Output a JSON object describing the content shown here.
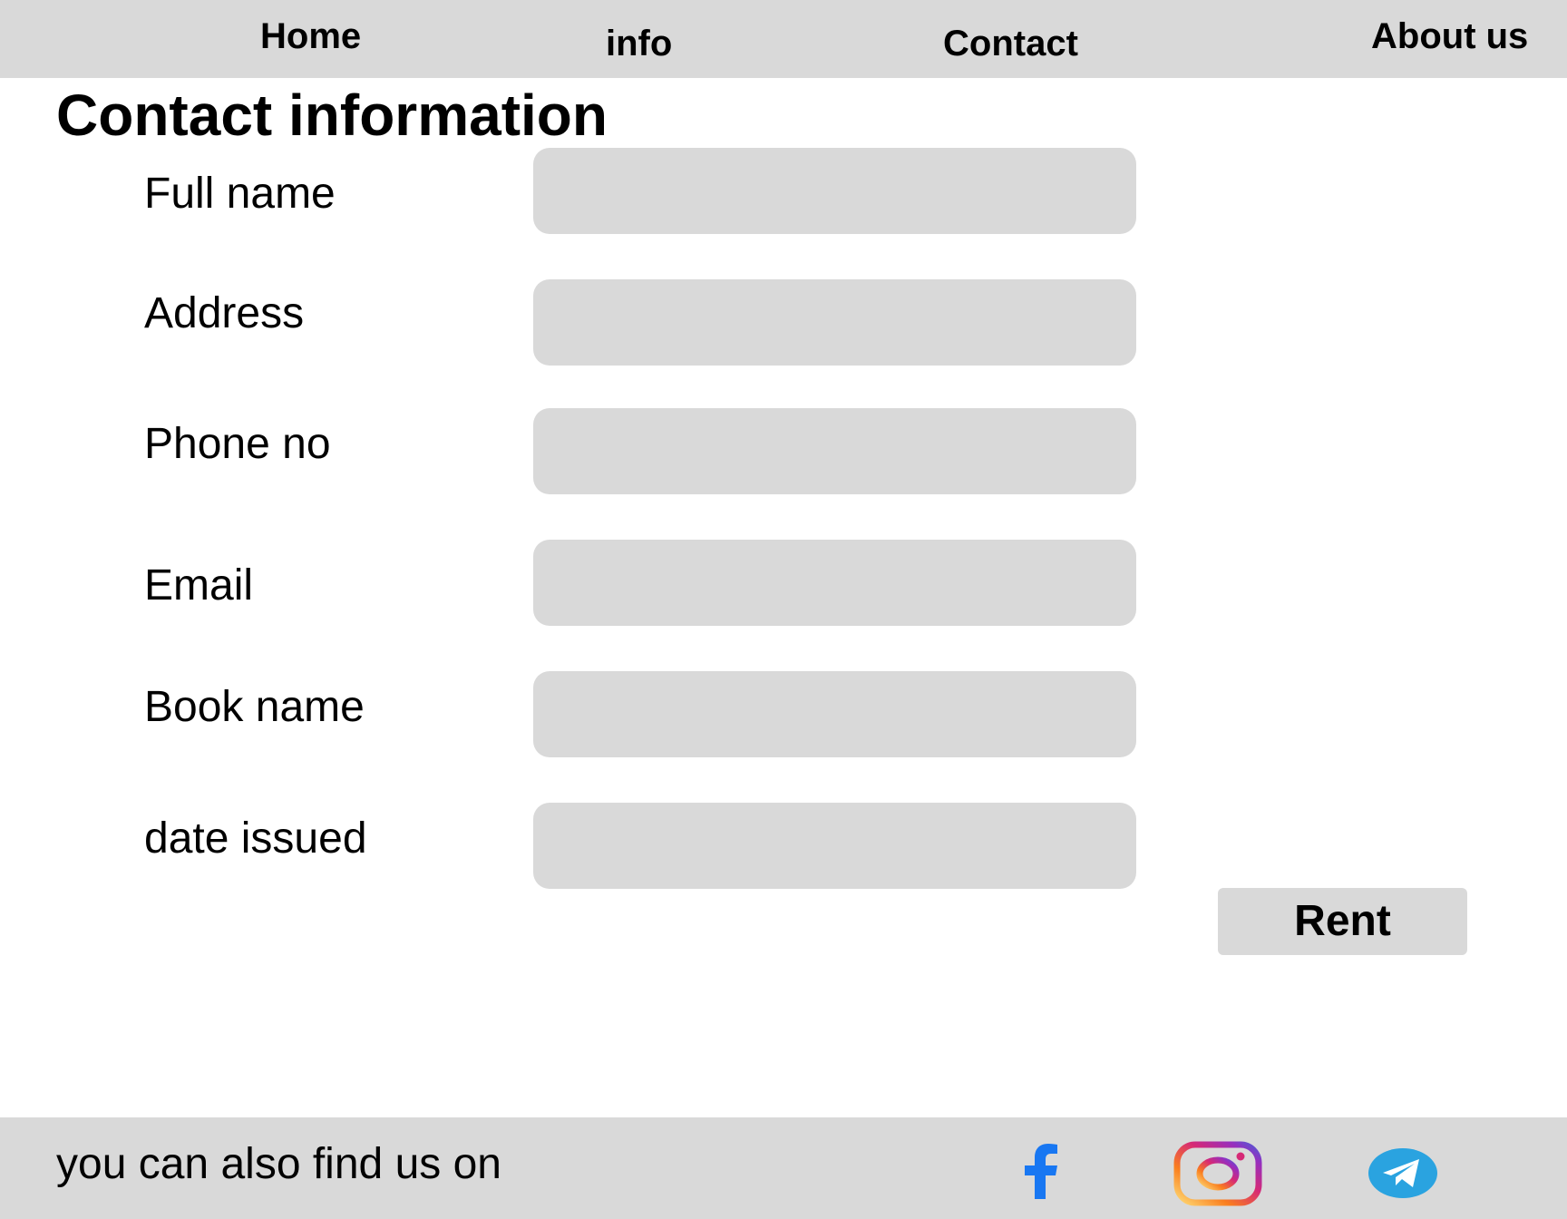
{
  "nav": {
    "items": [
      {
        "label": "Home"
      },
      {
        "label": "info"
      },
      {
        "label": "Contact"
      },
      {
        "label": "About us"
      }
    ]
  },
  "page": {
    "title": "Contact information"
  },
  "form": {
    "fields": [
      {
        "label": "Full name",
        "value": ""
      },
      {
        "label": "Address",
        "value": ""
      },
      {
        "label": "Phone no",
        "value": ""
      },
      {
        "label": "Email",
        "value": ""
      },
      {
        "label": "Book name",
        "value": ""
      },
      {
        "label": "date issued",
        "value": ""
      }
    ],
    "submit_label": "Rent"
  },
  "footer": {
    "text": "you can also find us on",
    "social": [
      {
        "icon": "facebook-icon",
        "color": "#1877f2"
      },
      {
        "icon": "instagram-icon",
        "color": "#e1306c"
      },
      {
        "icon": "telegram-icon",
        "color": "#2aa3e0"
      }
    ]
  },
  "colors": {
    "bar_background": "#d9d9d9",
    "input_background": "#d9d9d9",
    "page_background": "#ffffff"
  }
}
